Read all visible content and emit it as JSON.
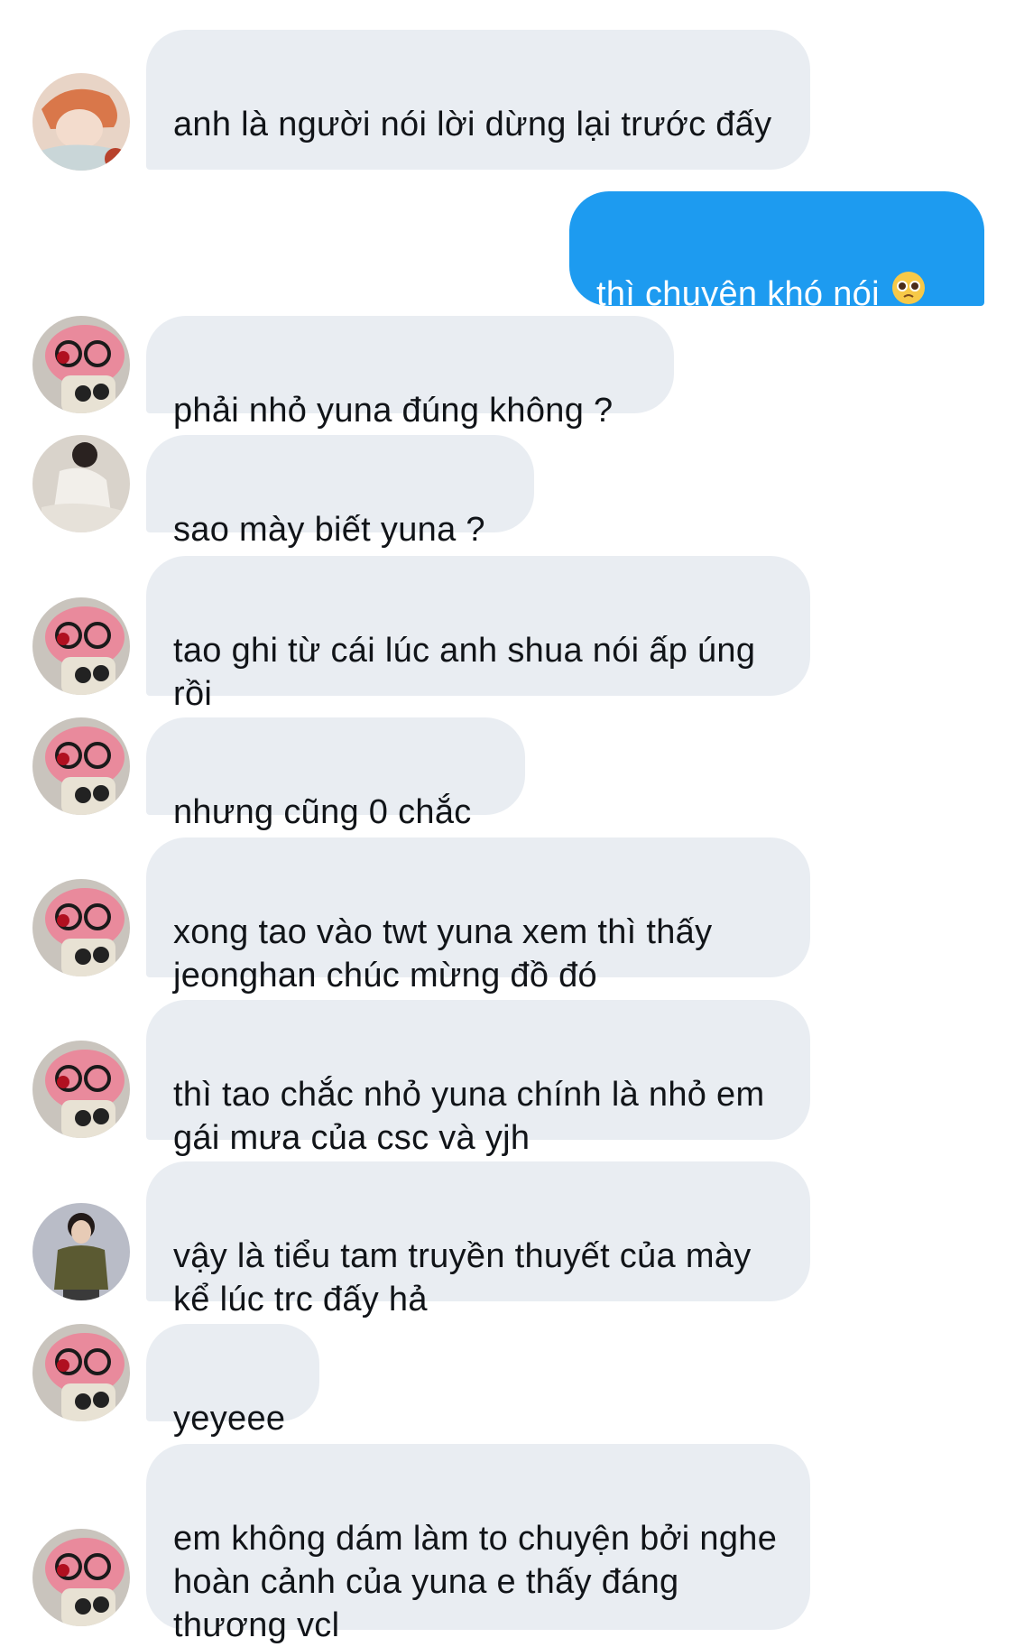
{
  "messages": [
    {
      "side": "in",
      "avatar": "orange-hair-avatar",
      "text": "anh là người nói lời dừng lại trước đấy"
    },
    {
      "side": "out",
      "text": "thì chuyện khó nói",
      "emoji": "pleading-face-emoji"
    },
    {
      "side": "in",
      "avatar": "pink-plush-avatar",
      "text": "phải nhỏ yuna đúng không ?"
    },
    {
      "side": "in",
      "avatar": "white-outfit-avatar",
      "text": "sao mày biết yuna ?"
    },
    {
      "side": "in",
      "avatar": "pink-plush-avatar",
      "text": "tao ghi từ cái lúc anh shua nói ấp úng rồi"
    },
    {
      "side": "in",
      "avatar": "pink-plush-avatar",
      "text": "nhưng cũng 0 chắc"
    },
    {
      "side": "in",
      "avatar": "pink-plush-avatar",
      "text": "xong tao vào twt yuna xem thì thấy jeonghan chúc mừng đồ đó"
    },
    {
      "side": "in",
      "avatar": "pink-plush-avatar",
      "text": "thì tao chắc nhỏ yuna chính là nhỏ em gái mưa của csc và yjh"
    },
    {
      "side": "in",
      "avatar": "olive-shirt-avatar",
      "text": "vậy là tiểu tam truyền thuyết của mày kể lúc trc đấy hả"
    },
    {
      "side": "in",
      "avatar": "pink-plush-avatar",
      "text": "yeyeee"
    },
    {
      "side": "in",
      "avatar": "pink-plush-avatar",
      "text": "em không dám làm to chuyện bởi nghe hoàn cảnh của yuna e thấy đáng thương vcl"
    }
  ],
  "colors": {
    "incoming_bubble": "#e9edf2",
    "outgoing_bubble": "#1d9bf0",
    "text": "#111418"
  }
}
